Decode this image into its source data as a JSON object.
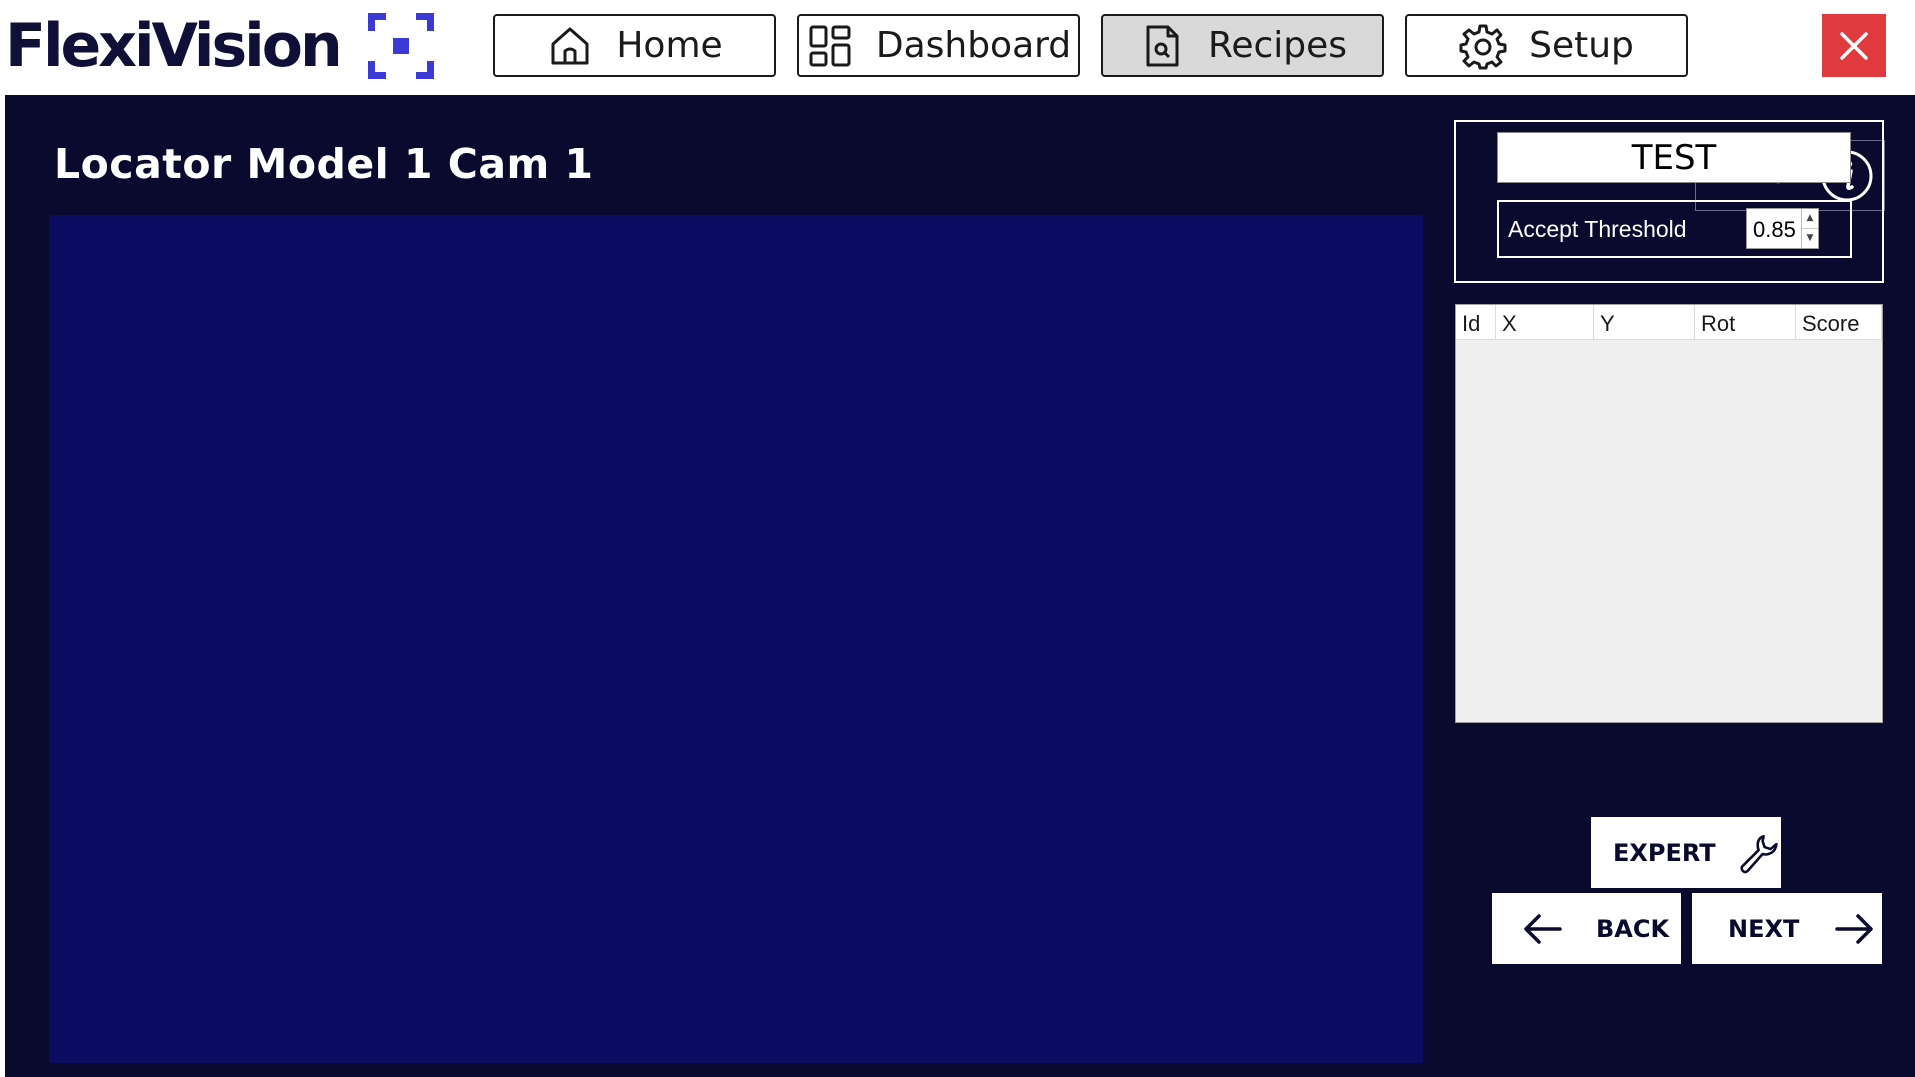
{
  "app": {
    "logo_text": "FlexiVision"
  },
  "nav": {
    "home": {
      "label": "Home",
      "icon": "home-icon"
    },
    "dashboard": {
      "label": "Dashboard",
      "icon": "dashboard-grid-icon"
    },
    "recipes": {
      "label": "Recipes",
      "icon": "document-search-icon",
      "active": true
    },
    "setup": {
      "label": "Setup",
      "icon": "gear-icon"
    },
    "close_icon": "close-icon"
  },
  "page": {
    "title": "Locator Model 1 Cam 1",
    "info_label": "INFO"
  },
  "test_panel": {
    "test_label": "TEST",
    "threshold_label": "Accept Threshold",
    "threshold_value": "0.85"
  },
  "results_table": {
    "columns": [
      "Id",
      "X",
      "Y",
      "Rot",
      "Score"
    ],
    "rows": []
  },
  "actions": {
    "expert_label": "EXPERT",
    "back_label": "BACK",
    "next_label": "NEXT"
  },
  "colors": {
    "panel_bg": "#0a0a2e",
    "viewer_bg": "#0b0b62",
    "accent": "#3a3ad6",
    "close_bg": "#e03a3e"
  }
}
